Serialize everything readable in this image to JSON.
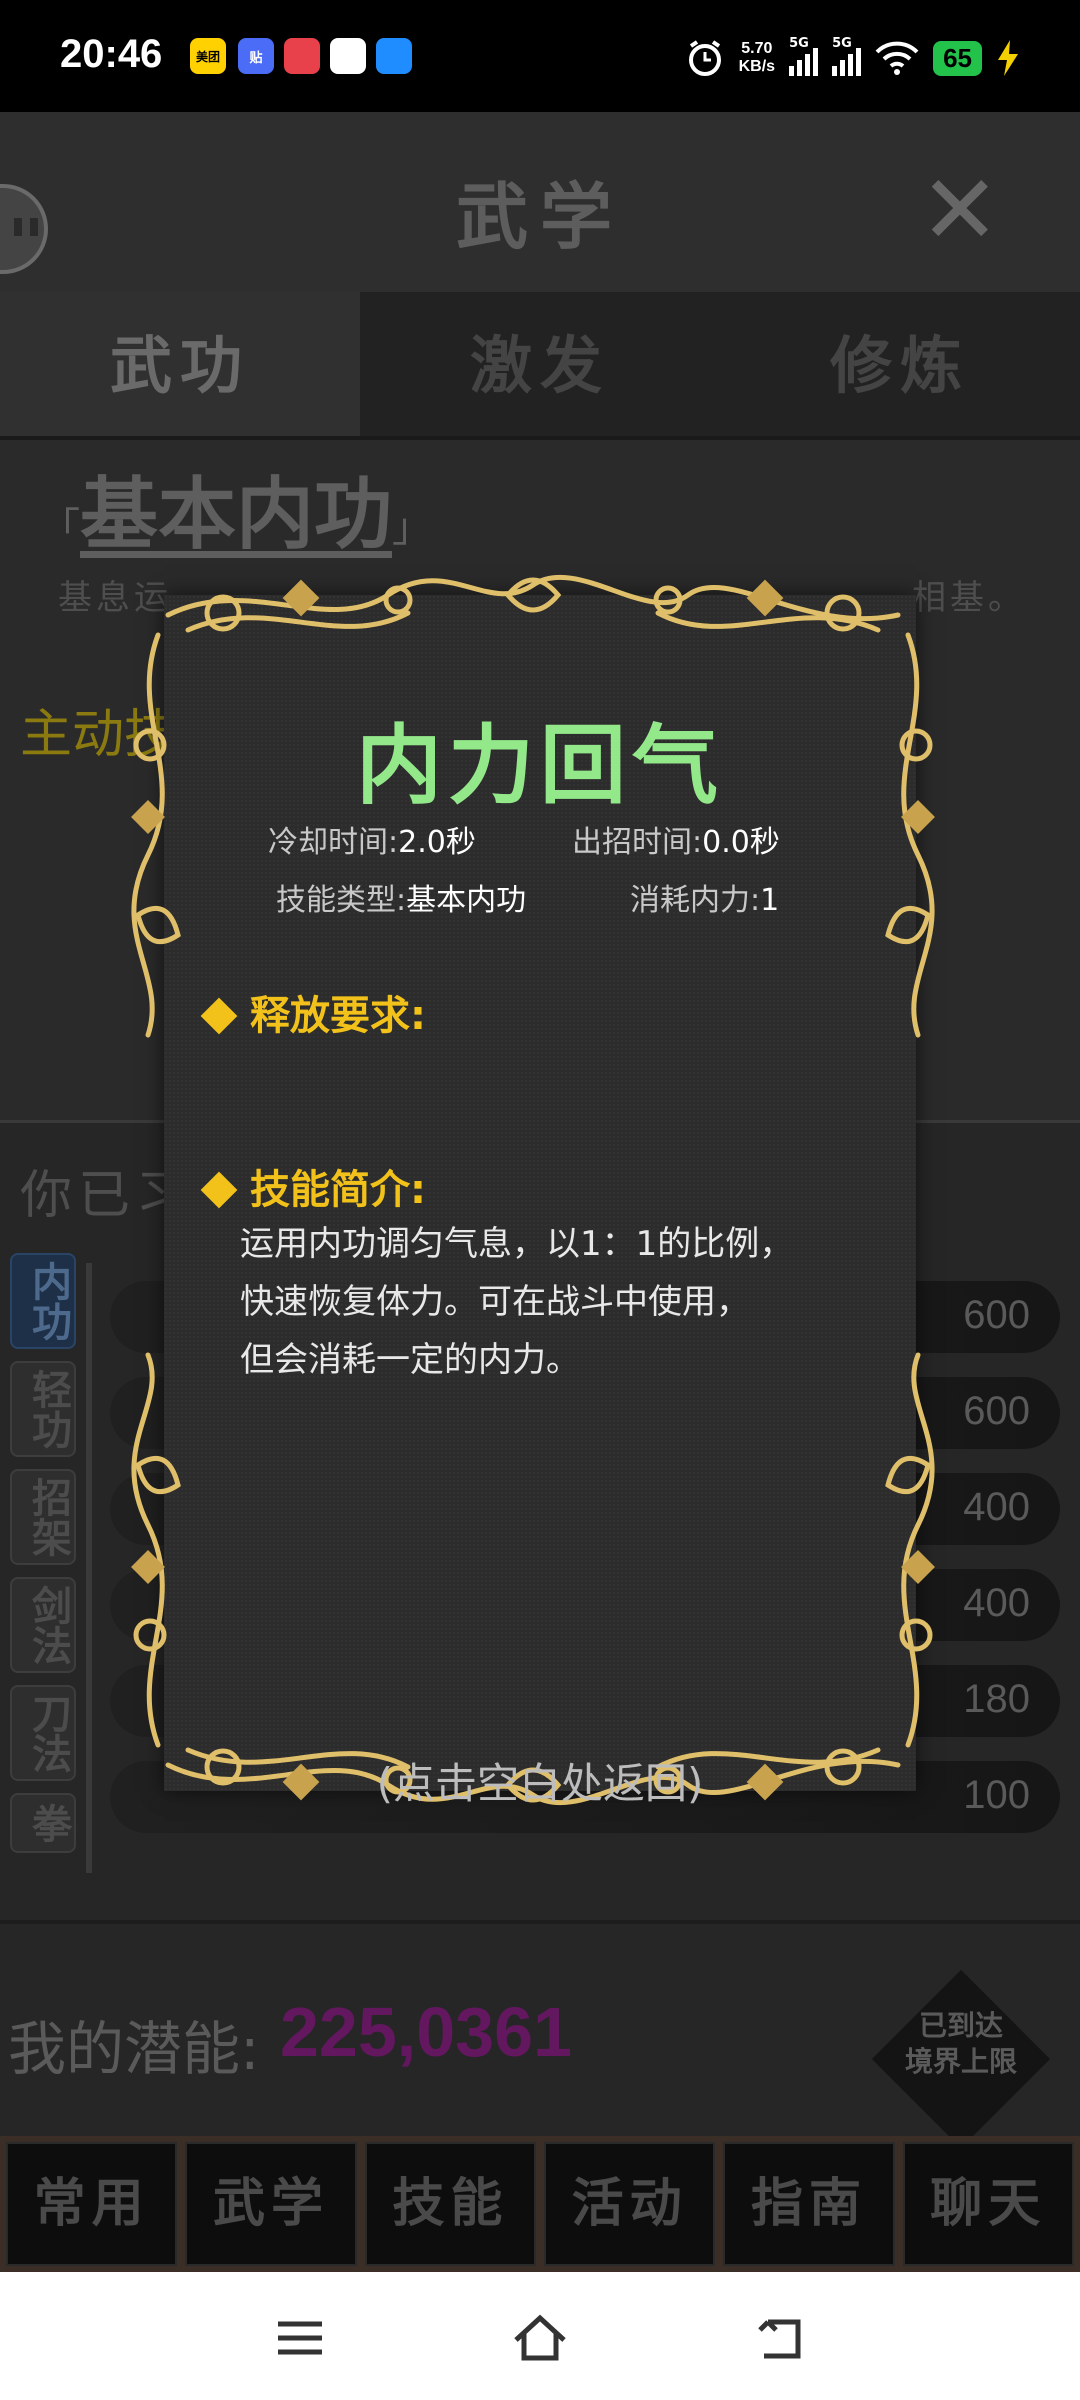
{
  "status_bar": {
    "time": "20:46",
    "apps": [
      "美团",
      "贴",
      "",
      "",
      ""
    ],
    "net_speed_value": "5.70",
    "net_speed_unit": "KB/s",
    "signal_1": "5G",
    "signal_2": "5G",
    "battery": "65"
  },
  "header": {
    "title": "武学",
    "close_label": "✕"
  },
  "tabs": [
    {
      "label": "武功",
      "active": true
    },
    {
      "label": "激发",
      "active": false
    },
    {
      "label": "修炼",
      "active": false
    }
  ],
  "skill": {
    "bracket_open": "「",
    "name": "基本内功",
    "bracket_close": "」",
    "description_visible": "基息运",
    "description_tail": "相基。",
    "active_label": "主动技"
  },
  "learned": {
    "title": "你已习",
    "categories": [
      "内功",
      "轻功",
      "招架",
      "剑法",
      "刀法",
      "拳"
    ],
    "row_values": [
      "600",
      "600",
      "400",
      "400",
      "180",
      "100"
    ]
  },
  "potential": {
    "label": "我的潜能:",
    "value": "225,0361",
    "limit_line1": "已到达",
    "limit_line2": "境界上限"
  },
  "bottom_nav": [
    "常用",
    "武学",
    "技能",
    "活动",
    "指南",
    "聊天"
  ],
  "dialog": {
    "title": "内力回气",
    "cooldown_label": "冷却时间:",
    "cooldown_value": "2.0秒",
    "cast_label": "出招时间:",
    "cast_value": "0.0秒",
    "type_label": "技能类型:",
    "type_value": "基本内功",
    "cost_label": "消耗内力:",
    "cost_value": "1",
    "req_title": "释放要求:",
    "intro_title": "技能简介:",
    "intro_line1": "运用内功调匀气息，以1：1的比例，",
    "intro_line2": "快速恢复体力。可在战斗中使用，",
    "intro_line3": "但会消耗一定的内力。",
    "close_hint": "(点击空白处返回)"
  },
  "colors": {
    "dialog_title": "#93e88a",
    "section_title": "#f2c21b",
    "potential_value": "#62175f",
    "frame_gold": "#e0bf6a"
  }
}
